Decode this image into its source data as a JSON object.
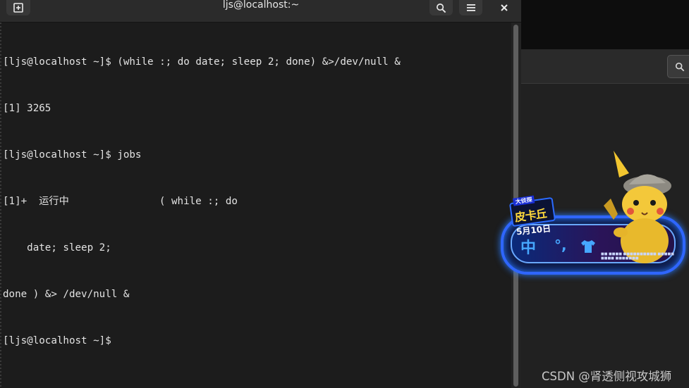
{
  "window": {
    "title": "ljs@localhost:~"
  },
  "icons": {
    "new_tab": "new-tab-icon",
    "search": "search-icon",
    "menu": "hamburger-menu-icon",
    "close": "close-icon"
  },
  "terminal": {
    "lines": [
      "[ljs@localhost ~]$ (while :; do date; sleep 2; done) &>/dev/null &",
      "[1] 3265",
      "[ljs@localhost ~]$ jobs",
      "[1]+  运行中               ( while :; do",
      "    date; sleep 2;",
      "done ) &> /dev/null &",
      "[ljs@localhost ~]$ "
    ]
  },
  "ad": {
    "tag_top": "大侦探",
    "tag_title": "皮卡丘",
    "date": "5月10日",
    "glyph_1": "中",
    "glyph_2": "°,",
    "fineprint": "■■ ■■■■ ■■■■■■■■■■ ■■■■■\n■■■■ ■■■■■■■"
  },
  "watermark": "CSDN @肾透侧视攻城狮",
  "colors": {
    "terminal_bg": "#1c1c1c",
    "titlebar_bg": "#2b2b2b",
    "text": "#e3e3e3",
    "ad_blue": "#2f66ff"
  }
}
